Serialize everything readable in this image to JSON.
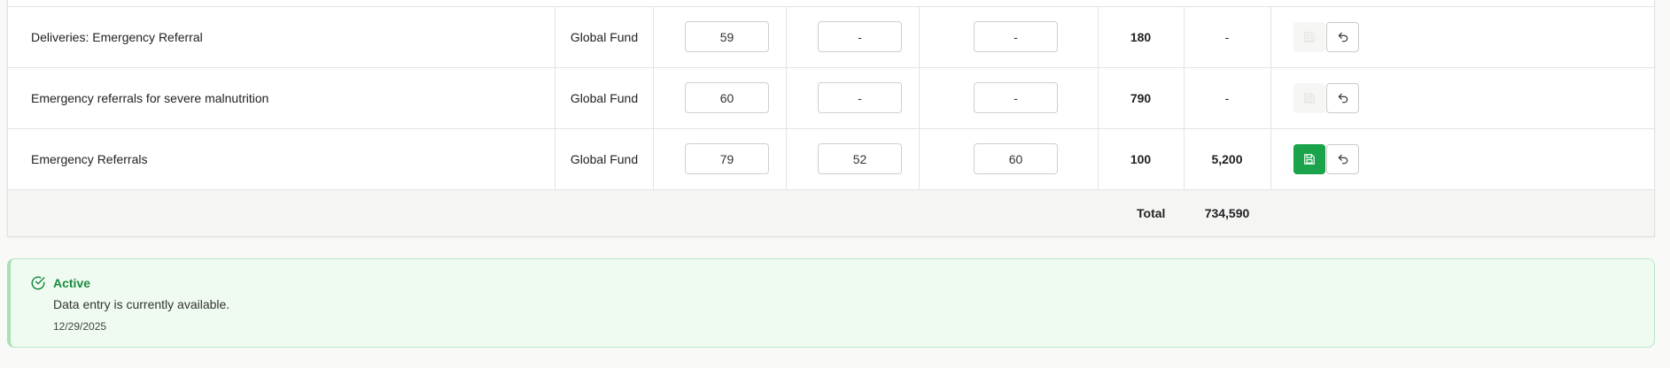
{
  "table": {
    "rows": [
      {
        "indicator": "Deliveries: Emergency Referral",
        "fund": "Global Fund",
        "input1": "59",
        "input2": "-",
        "input3": "-",
        "target": "180",
        "total": "-",
        "save_enabled": false
      },
      {
        "indicator": "Emergency referrals for severe malnutrition",
        "fund": "Global Fund",
        "input1": "60",
        "input2": "-",
        "input3": "-",
        "target": "790",
        "total": "-",
        "save_enabled": false
      },
      {
        "indicator": "Emergency Referrals",
        "fund": "Global Fund",
        "input1": "79",
        "input2": "52",
        "input3": "60",
        "target": "100",
        "total": "5,200",
        "save_enabled": true
      }
    ],
    "footer": {
      "label": "Total",
      "value": "734,590"
    }
  },
  "status": {
    "title": "Active",
    "message": "Data entry is currently available.",
    "date": "12/29/2025",
    "accent_color": "#1b8a3e"
  },
  "colors": {
    "save_button": "#1aa34a"
  }
}
